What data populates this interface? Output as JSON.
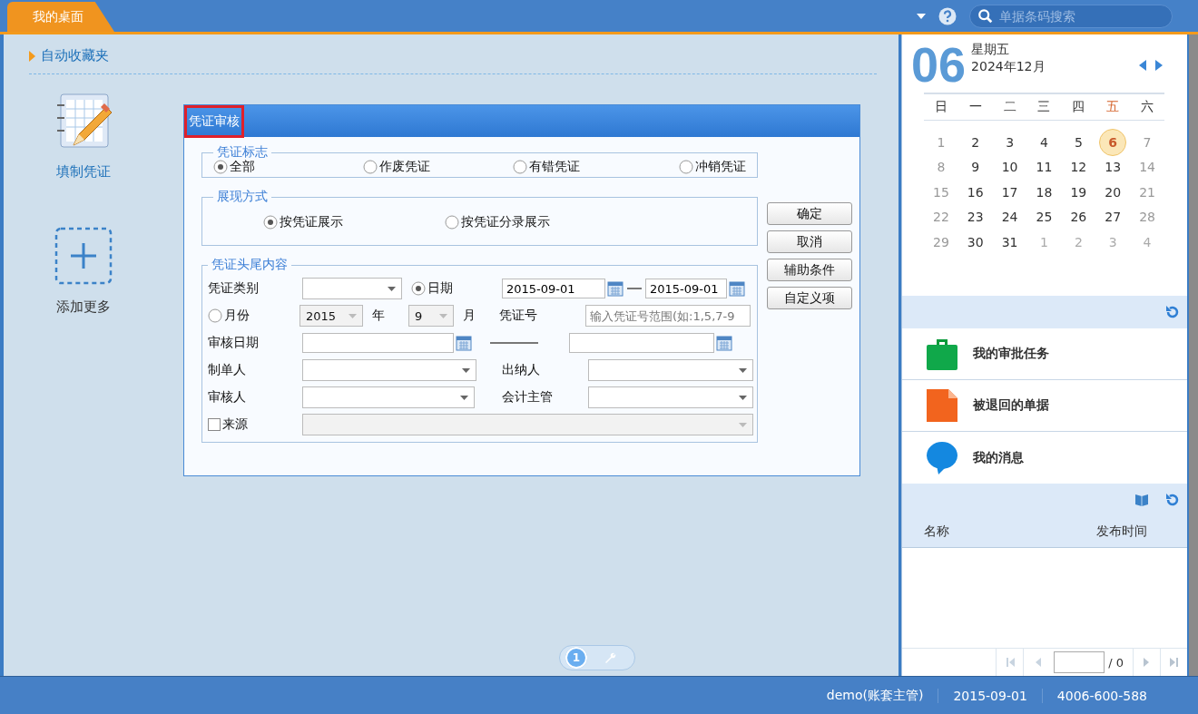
{
  "top_bar": {
    "tab": {
      "label": "我的桌面",
      "selected": true
    },
    "search": {
      "placeholder": "单据条码搜索"
    }
  },
  "desktop": {
    "section_title": "自动收藏夹",
    "shortcuts": [
      {
        "kind": "voucher",
        "label": "填制凭证"
      },
      {
        "kind": "add",
        "label": "添加更多"
      }
    ],
    "pages": [
      {
        "label": "1",
        "selected": true
      }
    ]
  },
  "dialog": {
    "title": "凭证审核",
    "group_1": {
      "title": "凭证标志",
      "options": [
        {
          "label": "全部",
          "selected": true
        },
        {
          "label": "作废凭证",
          "selected": false
        },
        {
          "label": "有错凭证",
          "selected": false
        },
        {
          "label": "冲销凭证",
          "selected": false
        }
      ]
    },
    "group_2": {
      "title": "展现方式",
      "options": [
        {
          "label": "按凭证展示",
          "selected": true
        },
        {
          "label": "按凭证分录展示",
          "selected": false
        }
      ]
    },
    "group_3": {
      "title": "凭证头尾内容",
      "rows": [
        {
          "items": [
            {
              "kind": "label",
              "text": "凭证类别"
            },
            {
              "kind": "select",
              "disabled": false
            },
            {
              "kind": "radio",
              "text": "日期",
              "selected": true
            },
            {
              "kind": "date",
              "value": "2015-09-01"
            },
            {
              "kind": "dash"
            },
            {
              "kind": "date",
              "value": "2015-09-01"
            }
          ]
        },
        {
          "items": [
            {
              "kind": "radio",
              "text": "月份",
              "selected": false
            },
            {
              "kind": "select",
              "value": "2015",
              "disabled": true
            },
            {
              "kind": "label",
              "text": "年"
            },
            {
              "kind": "select",
              "value": "9",
              "disabled": true
            },
            {
              "kind": "label",
              "text": "月"
            },
            {
              "kind": "label",
              "text": "凭证号"
            },
            {
              "kind": "input",
              "placeholder": "输入凭证号范围(如:1,5,7-9"
            }
          ]
        },
        {
          "items": [
            {
              "kind": "label",
              "text": "审核日期"
            },
            {
              "kind": "date"
            },
            {
              "kind": "dash"
            },
            {
              "kind": "date"
            }
          ]
        },
        {
          "items": [
            {
              "kind": "label",
              "text": "制单人"
            },
            {
              "kind": "select",
              "disabled": false
            },
            {
              "kind": "label",
              "text": "出纳人"
            },
            {
              "kind": "select",
              "disabled": false
            }
          ]
        },
        {
          "items": [
            {
              "kind": "label",
              "text": "审核人"
            },
            {
              "kind": "select",
              "disabled": false
            },
            {
              "kind": "label",
              "text": "会计主管"
            },
            {
              "kind": "select",
              "disabled": false
            }
          ]
        },
        {
          "items": [
            {
              "kind": "checkbox",
              "text": "来源",
              "checked": false
            },
            {
              "kind": "select",
              "disabled": true
            }
          ]
        }
      ]
    },
    "buttons": [
      "确定",
      "取消",
      "辅助条件",
      "自定义项"
    ]
  },
  "calendar": {
    "day": "06",
    "weekday": "星期五",
    "month": "2024年12月",
    "weekdays": [
      {
        "label": "日",
        "today": false
      },
      {
        "label": "一",
        "today": false
      },
      {
        "label": "二",
        "today": false
      },
      {
        "label": "三",
        "today": false
      },
      {
        "label": "四",
        "today": false
      },
      {
        "label": "五",
        "today": true
      },
      {
        "label": "六",
        "today": false
      }
    ],
    "days": [
      {
        "text": "1",
        "kind": "weekend",
        "selected": false
      },
      {
        "text": "2",
        "kind": "weekday",
        "selected": false
      },
      {
        "text": "3",
        "kind": "weekday",
        "selected": false
      },
      {
        "text": "4",
        "kind": "weekday",
        "selected": false
      },
      {
        "text": "5",
        "kind": "weekday",
        "selected": false
      },
      {
        "text": "6",
        "kind": "weekday",
        "selected": true
      },
      {
        "text": "7",
        "kind": "weekend",
        "selected": false
      },
      {
        "text": "8",
        "kind": "weekend",
        "selected": false
      },
      {
        "text": "9",
        "kind": "weekday",
        "selected": false
      },
      {
        "text": "10",
        "kind": "weekday",
        "selected": false
      },
      {
        "text": "11",
        "kind": "weekday",
        "selected": false
      },
      {
        "text": "12",
        "kind": "weekday",
        "selected": false
      },
      {
        "text": "13",
        "kind": "weekday",
        "selected": false
      },
      {
        "text": "14",
        "kind": "weekend",
        "selected": false
      },
      {
        "text": "15",
        "kind": "weekend",
        "selected": false
      },
      {
        "text": "16",
        "kind": "weekday",
        "selected": false
      },
      {
        "text": "17",
        "kind": "weekday",
        "selected": false
      },
      {
        "text": "18",
        "kind": "weekday",
        "selected": false
      },
      {
        "text": "19",
        "kind": "weekday",
        "selected": false
      },
      {
        "text": "20",
        "kind": "weekday",
        "selected": false
      },
      {
        "text": "21",
        "kind": "weekend",
        "selected": false
      },
      {
        "text": "22",
        "kind": "weekend",
        "selected": false
      },
      {
        "text": "23",
        "kind": "weekday",
        "selected": false
      },
      {
        "text": "24",
        "kind": "weekday",
        "selected": false
      },
      {
        "text": "25",
        "kind": "weekday",
        "selected": false
      },
      {
        "text": "26",
        "kind": "weekday",
        "selected": false
      },
      {
        "text": "27",
        "kind": "weekday",
        "selected": false
      },
      {
        "text": "28",
        "kind": "weekend",
        "selected": false
      },
      {
        "text": "29",
        "kind": "weekend",
        "selected": false
      },
      {
        "text": "30",
        "kind": "weekday",
        "selected": false
      },
      {
        "text": "31",
        "kind": "weekday",
        "selected": false
      },
      {
        "text": "1",
        "kind": "other",
        "selected": false
      },
      {
        "text": "2",
        "kind": "other",
        "selected": false
      },
      {
        "text": "3",
        "kind": "other",
        "selected": false
      },
      {
        "text": "4",
        "kind": "other",
        "selected": false
      }
    ]
  },
  "tasks": [
    {
      "kind": "bag",
      "label": "我的审批任务"
    },
    {
      "kind": "doc",
      "label": "被退回的单据"
    },
    {
      "kind": "chat",
      "label": "我的消息"
    }
  ],
  "notices": {
    "columns": [
      "名称",
      "发布时间"
    ],
    "pager": {
      "total": "/ 0"
    }
  },
  "status_bar": [
    "demo(账套主管)",
    "2015-09-01",
    "4006-600-588"
  ]
}
